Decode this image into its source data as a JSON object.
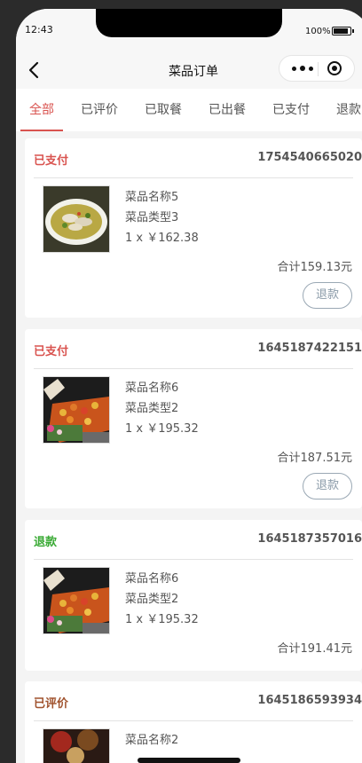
{
  "status_bar": {
    "time": "12:43",
    "battery": "100%"
  },
  "nav": {
    "title": "菜品订单"
  },
  "tabs": [
    "全部",
    "已评价",
    "已取餐",
    "已出餐",
    "已支付",
    "退款"
  ],
  "orders": [
    {
      "status": "已支付",
      "status_color": "#d9534f",
      "order_no": "1754540665020",
      "dish_name": "菜品名称5",
      "dish_type": "菜品类型3",
      "price_line": "1 x ￥162.38",
      "total": "合计159.13元",
      "refund_label": "退款"
    },
    {
      "status": "已支付",
      "status_color": "#d9534f",
      "order_no": "1645187422151",
      "dish_name": "菜品名称6",
      "dish_type": "菜品类型2",
      "price_line": "1 x ￥195.32",
      "total": "合计187.51元",
      "refund_label": "退款"
    },
    {
      "status": "退款",
      "status_color": "#3aaa35",
      "order_no": "1645187357016",
      "dish_name": "菜品名称6",
      "dish_type": "菜品类型2",
      "price_line": "1 x ￥195.32",
      "total": "合计191.41元"
    },
    {
      "status": "已评价",
      "status_color": "#a0522d",
      "order_no": "1645186593934",
      "dish_name": "菜品名称2"
    }
  ]
}
